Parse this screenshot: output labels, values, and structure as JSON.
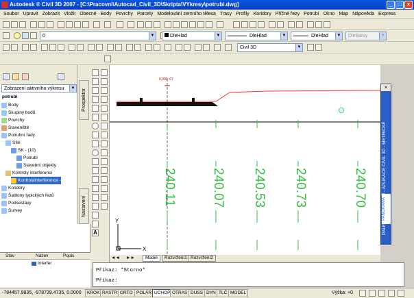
{
  "title": "Autodesk ® Civil 3D 2007 - [C:\\Pracovni\\Autocad_Civil_3D\\Skripta\\VYkresy\\potrubi.dwg]",
  "menu": [
    "Soubor",
    "Upravit",
    "Zobrazit",
    "Vložit",
    "Obecné",
    "Body",
    "Povrchy",
    "Parcely",
    "Modelování zemního tělesa",
    "Trasy",
    "Profily",
    "Koridory",
    "Příčné řezy",
    "Potrubí",
    "Okno",
    "Map",
    "Nápověda",
    "Express"
  ],
  "toolbar": {
    "layer_value": "0",
    "color_value": "DleHlad",
    "linetype_value": "DleHlad",
    "lineweight_value": "DleHlad",
    "plotstyle_value": "DleBarvy",
    "workspace_value": "Civil 3D"
  },
  "left_panel": {
    "view_combo": "Zobrazení aktivního výkresu",
    "tabs": {
      "prospector": "Prospektor",
      "settings": "Nastavení"
    },
    "tree": [
      {
        "label": "potrubi",
        "bold": true
      },
      {
        "label": "Body"
      },
      {
        "label": "Skupiny bodů"
      },
      {
        "label": "Povrchy"
      },
      {
        "label": "Staveniště"
      },
      {
        "label": "Potrubní řady"
      },
      {
        "label": "Sítě"
      },
      {
        "label": "SK - (10)"
      },
      {
        "label": "Potrubí"
      },
      {
        "label": "Stavební objekty"
      },
      {
        "label": "Kontroly interferencí"
      },
      {
        "label": "KontrolaInterference - ",
        "selected": true
      },
      {
        "label": "Koridory"
      },
      {
        "label": "Šablony typických řezů"
      },
      {
        "label": "Podsestavy"
      },
      {
        "label": "Survey"
      }
    ],
    "list_headers": [
      "Stav",
      "Název",
      "Popis"
    ],
    "list_row": "Interfer"
  },
  "canvas": {
    "marker_label": "0,000: 67",
    "elevations": [
      "240.11",
      "240.07",
      "240.53",
      "240.73",
      "240.70"
    ],
    "ucs_y": "Y",
    "ucs_x": "X"
  },
  "layout_tabs": [
    "Model",
    "Rozvržení1",
    "Rozvržení2"
  ],
  "palette_title": "PALETY NÁSTROJŮ - APLIKACE CIVIL 3D - METRICKÉ",
  "palette_tab": "PANORAMA",
  "command": {
    "line1": "Příkaz: *Storno*",
    "line2": "Příkaz:"
  },
  "status": {
    "coords": "-784457.9835, -978739.4735, 0.0000",
    "toggles": [
      "KROK",
      "RASTR",
      "ORTO",
      "POLÁR",
      "UCHOP",
      "OTRAS",
      "DUSS",
      "DYN",
      "TLČ",
      "MODEL"
    ],
    "elevation": "Výška: +0"
  },
  "colors": {
    "titlebar": "#0a4fd8",
    "profile_line": "#ff3030",
    "elevation_text": "#30c040",
    "palette": "#2a5fc8"
  }
}
